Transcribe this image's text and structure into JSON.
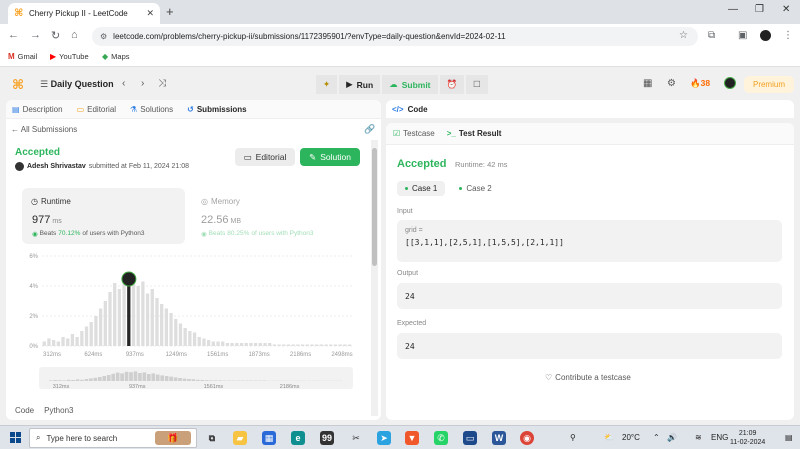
{
  "browser": {
    "tab_title": "Cherry Pickup II - LeetCode",
    "url": "leetcode.com/problems/cherry-pickup-ii/submissions/1172395901/?envType=daily-question&envId=2024-02-11",
    "bookmarks": [
      {
        "label": "Gmail",
        "icon": "gmail-icon"
      },
      {
        "label": "YouTube",
        "icon": "youtube-icon"
      },
      {
        "label": "Maps",
        "icon": "maps-icon"
      }
    ]
  },
  "nav": {
    "daily_question": "Daily Question",
    "run": "Run",
    "submit": "Submit",
    "streak": "38",
    "premium": "Premium"
  },
  "left": {
    "tabs": [
      {
        "label": "Description",
        "icon": "description-icon"
      },
      {
        "label": "Editorial",
        "icon": "editorial-icon"
      },
      {
        "label": "Solutions",
        "icon": "solutions-icon"
      },
      {
        "label": "Submissions",
        "icon": "submissions-icon"
      }
    ],
    "all_submissions": "All Submissions",
    "status": "Accepted",
    "author": "Adesh Shrivastav",
    "submitted_at": "submitted at Feb 11, 2024 21:08",
    "editorial_btn": "Editorial",
    "solution_btn": "Solution",
    "runtime": {
      "label": "Runtime",
      "value": "977",
      "unit": "ms",
      "beats_prefix": "Beats",
      "beats_pct": "70.12%",
      "beats_suffix": "of users with Python3"
    },
    "memory": {
      "label": "Memory",
      "value": "22.56",
      "unit": "MB",
      "beats_prefix": "Beats",
      "beats_pct": "80.25%",
      "beats_suffix": "of users with Python3"
    },
    "code_label": "Code",
    "language": "Python3"
  },
  "chart_data": {
    "type": "bar",
    "y_ticks": [
      "6%",
      "4%",
      "2%",
      "0%"
    ],
    "ylim": [
      0,
      6
    ],
    "x_ticks": [
      "312ms",
      "624ms",
      "937ms",
      "1249ms",
      "1561ms",
      "1873ms",
      "2186ms",
      "2498ms"
    ],
    "values": [
      0.3,
      0.5,
      0.4,
      0.3,
      0.6,
      0.5,
      0.8,
      0.6,
      1.0,
      1.3,
      1.6,
      2.0,
      2.5,
      3.0,
      3.6,
      4.2,
      3.8,
      4.6,
      4.4,
      4.8,
      4.0,
      4.3,
      3.5,
      3.8,
      3.2,
      2.8,
      2.5,
      2.2,
      1.8,
      1.5,
      1.2,
      1.0,
      0.9,
      0.6,
      0.5,
      0.4,
      0.3,
      0.3,
      0.3,
      0.2,
      0.2,
      0.2,
      0.2,
      0.2,
      0.2,
      0.2,
      0.2,
      0.2,
      0.2,
      0.1,
      0.1,
      0.1,
      0.1,
      0.1,
      0.1,
      0.1,
      0.1,
      0.1,
      0.1,
      0.1,
      0.1,
      0.1,
      0.1,
      0.1,
      0.1,
      0.1
    ],
    "highlight_index": 18,
    "minimap_ticks": [
      "312ms",
      "937ms",
      "1561ms",
      "2186ms"
    ]
  },
  "right": {
    "code_title": "Code",
    "tabs": [
      {
        "label": "Testcase",
        "icon": "checkbox-icon"
      },
      {
        "label": "Test Result",
        "icon": "terminal-icon"
      }
    ],
    "status": "Accepted",
    "runtime_text": "Runtime: 42 ms",
    "cases": [
      "Case 1",
      "Case 2"
    ],
    "input_label": "Input",
    "input_var": "grid =",
    "input_value": "[[3,1,1],[2,5,1],[1,5,5],[2,1,1]]",
    "output_label": "Output",
    "output_value": "24",
    "expected_label": "Expected",
    "expected_value": "24",
    "contribute": "Contribute a testcase"
  },
  "taskbar": {
    "search_placeholder": "Type here to search",
    "weather": "20°C",
    "lang": "ENG",
    "time": "21:09",
    "date": "11-02-2024"
  },
  "colors": {
    "accent_green": "#2db55d",
    "brand_orange": "#f89f1b"
  }
}
